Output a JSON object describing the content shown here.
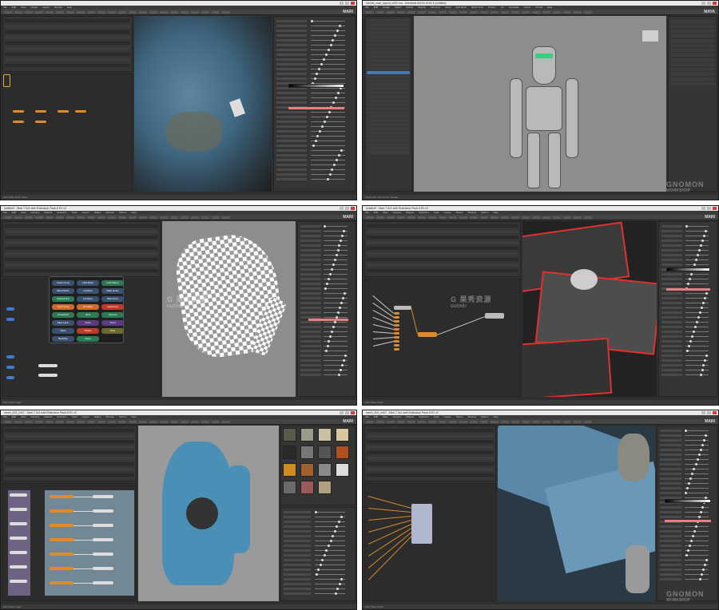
{
  "tiles": [
    {
      "title": "",
      "menu": [
        "File",
        "Edit",
        "View",
        "Nodes",
        "Layers",
        "Render",
        "Help"
      ],
      "status": "Mari Fade Script Stack",
      "brand": "MARI"
    },
    {
      "title": "robotic_mari_layout_v002.ma - Autodesk MAYA 2018.3 (Untitled)",
      "menu": [
        "File",
        "Edit",
        "Create",
        "Select",
        "Modify",
        "Display",
        "Windows",
        "Mesh",
        "Edit Mesh",
        "Mesh Tools",
        "Deform",
        "UV",
        "Generate",
        "Cache",
        "Arnold",
        "Help"
      ],
      "status": "Select Item and drag to update",
      "brand": "MAYA",
      "watermark": "GNOMON",
      "watermark_sub": "WORKSHOP"
    },
    {
      "title": "Untitled* - Mari 7.0v1 with Extension Pack 6 R1 v2",
      "menu": [
        "File",
        "Edit",
        "View",
        "Camera",
        "Objects",
        "Selection",
        "Tools",
        "Layers",
        "Nodes",
        "Shelves",
        "Python",
        "Help"
      ],
      "status": "Mari Node Graph",
      "brand": "MARI",
      "popup_buttons": [
        "Grade Group",
        "Multi Mask",
        "Color Ramp",
        "Blend Mode",
        "Gradient",
        "Mask Group",
        "Ambient Occ",
        "Curvature",
        "Bake Point",
        "Color Group",
        "Dirt Mask",
        "Adjustment",
        "Procedural",
        "Paint",
        "Channel",
        "Bake Layer",
        "Noise",
        "Flood",
        "Mask",
        "Shader",
        "Node",
        "Backdrop",
        "Reset"
      ],
      "watermark": "G 果秀资源",
      "watermark_sub": "GUOXIU"
    },
    {
      "title": "Untitled* - Mari 7.0v1 with Extension Pack 6 R1 v2",
      "menu": [
        "File",
        "Edit",
        "View",
        "Camera",
        "Objects",
        "Selection",
        "Tools",
        "Layers",
        "Nodes",
        "Shelves",
        "Python",
        "Help"
      ],
      "status": "Mari Node Graph",
      "brand": "MARI",
      "watermark": "G 果秀资源",
      "watermark_sub": "GUOXIU"
    },
    {
      "title": "mech_001_v007 - Mari 7.0v1 with Extension Pack 6 R1 v2",
      "menu": [
        "File",
        "Edit",
        "View",
        "Camera",
        "Objects",
        "Selection",
        "Tools",
        "Layers",
        "Nodes",
        "Shelves",
        "Python",
        "Help"
      ],
      "status": "Mari Node Graph",
      "brand": "MARI"
    },
    {
      "title": "mech_001_v007 - Mari 7.0v1 with Extension Pack 6 R1 v2",
      "menu": [
        "File",
        "Edit",
        "View",
        "Camera",
        "Objects",
        "Selection",
        "Tools",
        "Layers",
        "Nodes",
        "Shelves",
        "Python",
        "Help"
      ],
      "status": "Mari Node Graph",
      "brand": "MARI",
      "watermark": "GNOMON",
      "watermark_sub": "WORKSHOP"
    }
  ],
  "colors": {
    "panel": "#353535",
    "node_orange": "#e08a2a",
    "node_blue": "#3f7ad0",
    "wire": "#d98a2b",
    "accent_pink": "#e88080",
    "viewport_grey": "#8d8d8d",
    "mech_blue": "#4a7a9a"
  }
}
